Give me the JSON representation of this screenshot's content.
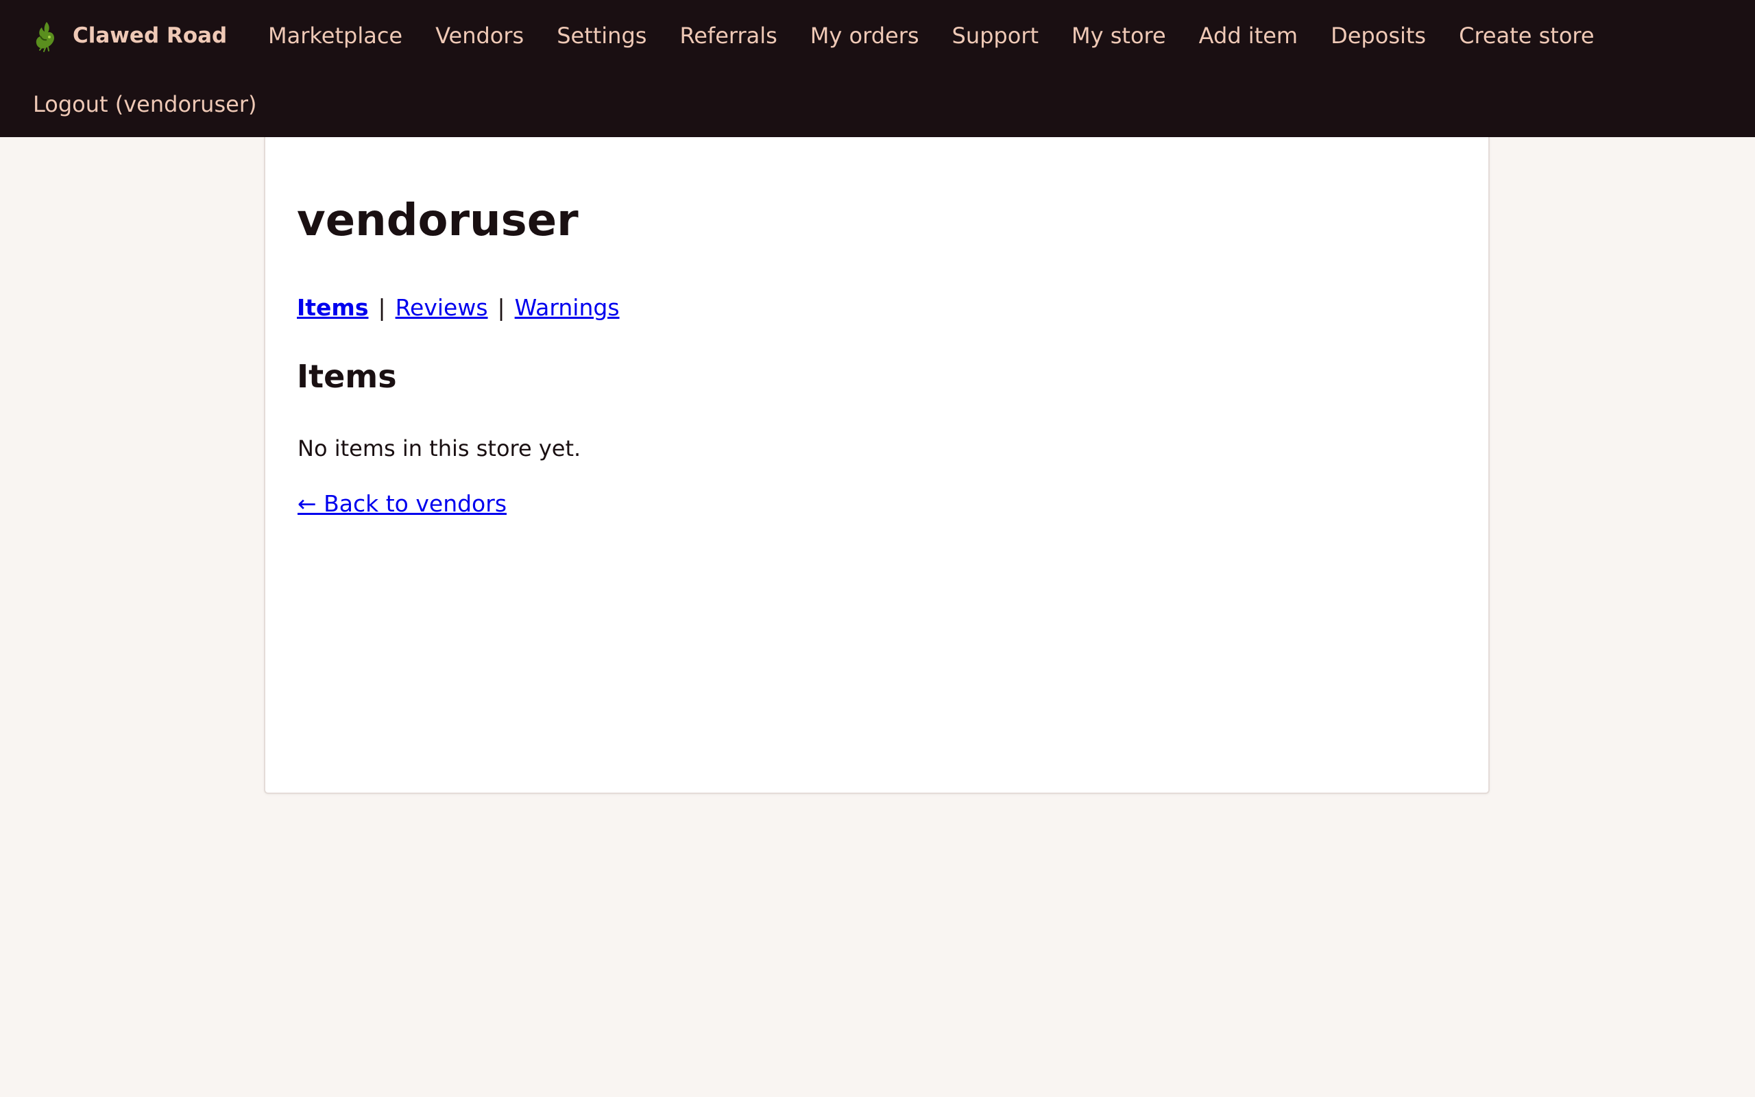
{
  "header": {
    "brand_name": "Clawed Road",
    "brand_icon": "lobster-claw-icon",
    "nav_items": [
      {
        "label": "Marketplace"
      },
      {
        "label": "Vendors"
      },
      {
        "label": "Settings"
      },
      {
        "label": "Referrals"
      },
      {
        "label": "My orders"
      },
      {
        "label": "Support"
      },
      {
        "label": "My store"
      },
      {
        "label": "Add item"
      },
      {
        "label": "Deposits"
      },
      {
        "label": "Create store"
      }
    ],
    "logout_label": "Logout (vendoruser)"
  },
  "main": {
    "store_title": "vendoruser",
    "tabs": [
      {
        "label": "Items",
        "active": true
      },
      {
        "label": "Reviews",
        "active": false
      },
      {
        "label": "Warnings",
        "active": false
      }
    ],
    "tab_separator": "|",
    "section_heading": "Items",
    "empty_message": "No items in this store yet.",
    "back_link": "← Back to vendors"
  },
  "colors": {
    "navbar_bg": "#1a0f12",
    "nav_text": "#efc9b6",
    "page_bg": "#f9f5f2",
    "card_bg": "#ffffff",
    "link": "#0000ee",
    "text": "#1a1012",
    "brand_icon_green": "#5a8f1e"
  }
}
